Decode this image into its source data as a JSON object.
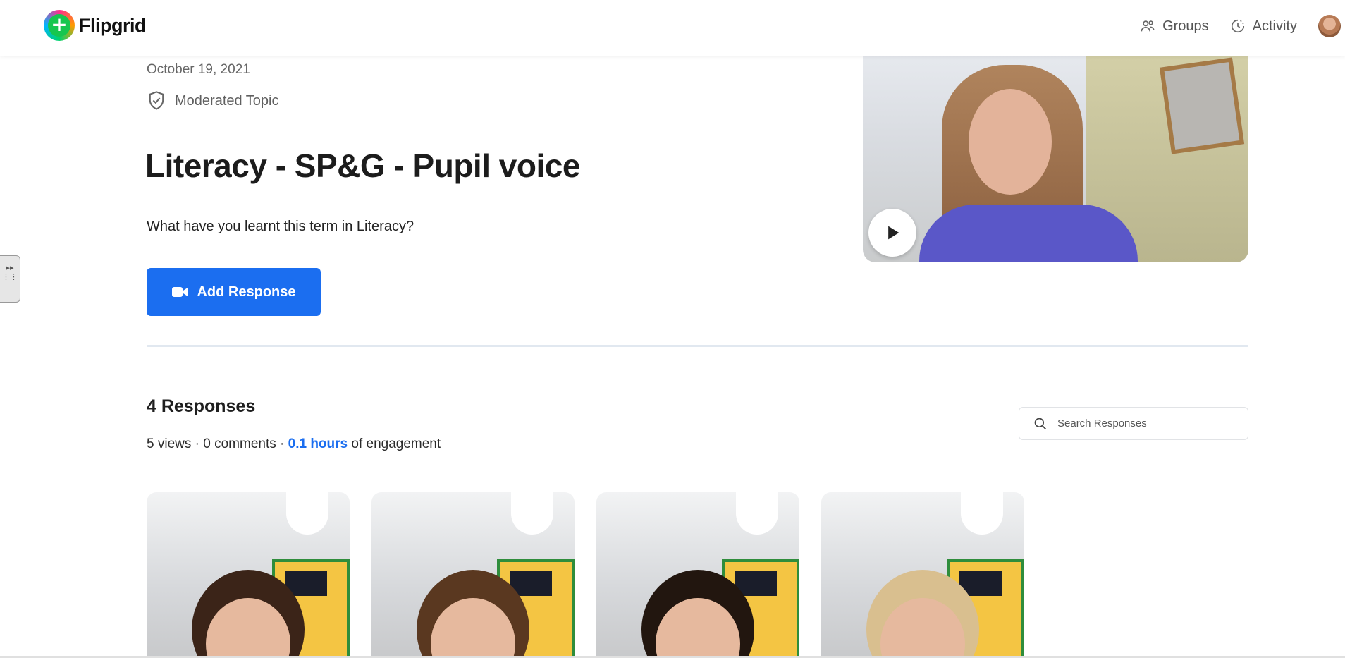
{
  "app": {
    "name": "Flipgrid"
  },
  "nav": {
    "groups_label": "Groups",
    "activity_label": "Activity"
  },
  "topic": {
    "date": "October 19, 2021",
    "moderation": "Moderated Topic",
    "title": "Literacy - SP&G - Pupil voice",
    "prompt": "What have you learnt this term in Literacy?",
    "add_response_label": "Add Response"
  },
  "responses": {
    "heading": "4 Responses",
    "views": "5 views",
    "comments": "0 comments",
    "separator": "·",
    "engagement_link": "0.1 hours",
    "engagement_suffix": "of engagement",
    "search_placeholder": "Search Responses",
    "cards": [
      {
        "hair": "#3b2418"
      },
      {
        "hair": "#5a3820"
      },
      {
        "hair": "#22160f"
      },
      {
        "hair": "#d9bf8f"
      }
    ]
  },
  "colors": {
    "accent": "#1b6ef0",
    "divider": "#e1e8f0"
  },
  "icons": {
    "groups": "people-icon",
    "activity": "clock-icon",
    "moderated": "shield-check-icon",
    "add_response": "video-camera-icon",
    "play": "play-icon",
    "search": "search-icon"
  }
}
